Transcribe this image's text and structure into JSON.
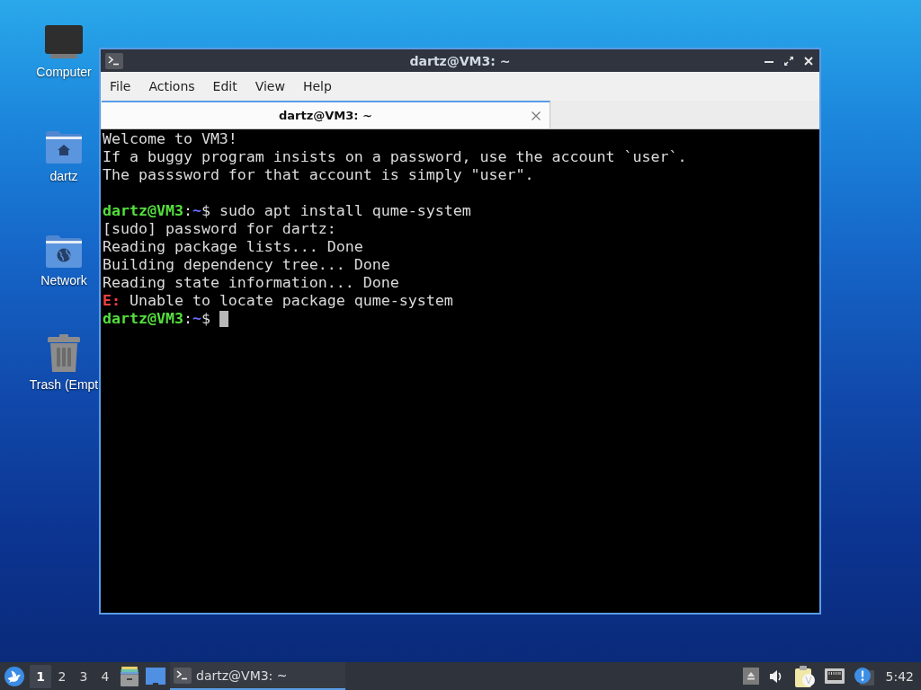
{
  "desktop": {
    "icons": [
      {
        "label": "Computer",
        "kind": "computer"
      },
      {
        "label": "dartz",
        "kind": "home"
      },
      {
        "label": "Network",
        "kind": "network"
      },
      {
        "label": "Trash (Empt",
        "kind": "trash"
      }
    ]
  },
  "window": {
    "title": "dartz@VM3: ~",
    "menu": [
      "File",
      "Actions",
      "Edit",
      "View",
      "Help"
    ],
    "tabs": [
      {
        "label": "dartz@VM3: ~",
        "selected": true
      }
    ]
  },
  "terminal": {
    "cursor": true,
    "lines": [
      {
        "kind": "output",
        "segments": [
          {
            "kind": "plain",
            "text": "Welcome to VM3!"
          }
        ]
      },
      {
        "kind": "output",
        "segments": [
          {
            "kind": "plain",
            "text": "If a buggy program insists on a password, use the account `user`."
          }
        ]
      },
      {
        "kind": "output",
        "segments": [
          {
            "kind": "plain",
            "text": "The passsword for that account is simply \"user\"."
          }
        ]
      },
      {
        "kind": "blank"
      },
      {
        "kind": "output",
        "segments": [
          {
            "kind": "user",
            "text": "dartz@VM3"
          },
          {
            "kind": "plain",
            "text": ":"
          },
          {
            "kind": "path",
            "text": "~"
          },
          {
            "kind": "plain",
            "text": "$ sudo apt install qume-system"
          }
        ]
      },
      {
        "kind": "output",
        "segments": [
          {
            "kind": "plain",
            "text": "[sudo] password for dartz:"
          }
        ]
      },
      {
        "kind": "output",
        "segments": [
          {
            "kind": "plain",
            "text": "Reading package lists... Done"
          }
        ]
      },
      {
        "kind": "output",
        "segments": [
          {
            "kind": "plain",
            "text": "Building dependency tree... Done"
          }
        ]
      },
      {
        "kind": "output",
        "segments": [
          {
            "kind": "plain",
            "text": "Reading state information... Done"
          }
        ]
      },
      {
        "kind": "output",
        "segments": [
          {
            "kind": "error",
            "text": "E:"
          },
          {
            "kind": "plain",
            "text": " Unable to locate package qume-system"
          }
        ]
      },
      {
        "kind": "output",
        "segments": [
          {
            "kind": "user",
            "text": "dartz@VM3"
          },
          {
            "kind": "plain",
            "text": ":"
          },
          {
            "kind": "path",
            "text": "~"
          },
          {
            "kind": "plain",
            "text": "$"
          }
        ]
      }
    ]
  },
  "taskbar": {
    "workspaces": [
      {
        "label": "1",
        "selected": true
      },
      {
        "label": "2",
        "selected": false
      },
      {
        "label": "3",
        "selected": false
      },
      {
        "label": "4",
        "selected": false
      }
    ],
    "tasks": [
      {
        "label": "dartz@VM3: ~",
        "selected": true
      }
    ],
    "clock": "5:42"
  }
}
